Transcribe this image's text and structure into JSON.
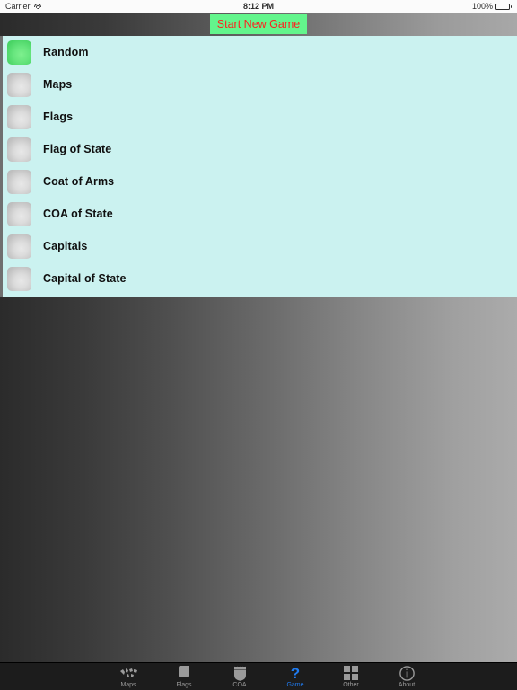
{
  "status_bar": {
    "carrier": "Carrier",
    "wifi_icon": "wifi-icon",
    "time": "8:12 PM",
    "battery_percent": "100%",
    "battery_icon": "battery-icon"
  },
  "nav_bar": {
    "start_button_label": "Start New Game",
    "start_button_bg": "#63f58c",
    "start_button_color": "#ff2020"
  },
  "list_panel": {
    "background": "#cbf2f0",
    "rows": [
      {
        "label": "Random",
        "selected": true
      },
      {
        "label": "Maps",
        "selected": false
      },
      {
        "label": "Flags",
        "selected": false
      },
      {
        "label": "Flag of State",
        "selected": false
      },
      {
        "label": "Coat of Arms",
        "selected": false
      },
      {
        "label": "COA of State",
        "selected": false
      },
      {
        "label": "Capitals",
        "selected": false
      },
      {
        "label": "Capital of State",
        "selected": false
      }
    ]
  },
  "tab_bar": {
    "accent_color": "#1f7bf0",
    "inactive_color": "#9a9a9a",
    "tabs": [
      {
        "label": "Maps",
        "icon": "world-map-icon",
        "selected": false
      },
      {
        "label": "Flags",
        "icon": "flag-icon",
        "selected": false
      },
      {
        "label": "COA",
        "icon": "shield-icon",
        "selected": false
      },
      {
        "label": "Game",
        "icon": "question-mark-icon",
        "selected": true
      },
      {
        "label": "Other",
        "icon": "grid-squares-icon",
        "selected": false
      },
      {
        "label": "About",
        "icon": "info-circle-icon",
        "selected": false
      }
    ]
  }
}
